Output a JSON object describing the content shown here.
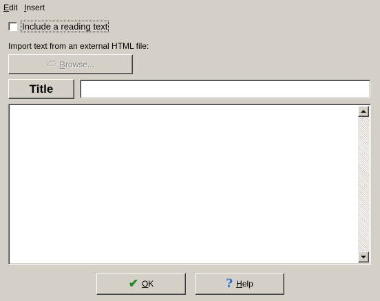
{
  "menu": {
    "edit": {
      "mnemonic": "E",
      "rest": "dit"
    },
    "insert": {
      "mnemonic": "I",
      "rest": "nsert"
    }
  },
  "reading_text": {
    "label": "Include a reading text",
    "checked": false
  },
  "import": {
    "label": "Import text from an external HTML file:",
    "browse": {
      "icon": "open-folder-icon",
      "glyph": "🗁",
      "mnemonic": "B",
      "rest": "rowse...",
      "disabled": true
    }
  },
  "title": {
    "button_label": "Title",
    "value": "",
    "placeholder": ""
  },
  "body_text": {
    "value": ""
  },
  "buttons": {
    "ok": {
      "icon": "checkmark-icon",
      "glyph": "✔",
      "mnemonic": "O",
      "rest": "K"
    },
    "help": {
      "icon": "question-mark-icon",
      "glyph": "?",
      "mnemonic": "H",
      "rest": "elp"
    }
  },
  "colors": {
    "background": "#d4d0c8",
    "ok_check": "#1f8a1f",
    "help_question": "#1a6fd6",
    "disabled_text": "#808080"
  }
}
